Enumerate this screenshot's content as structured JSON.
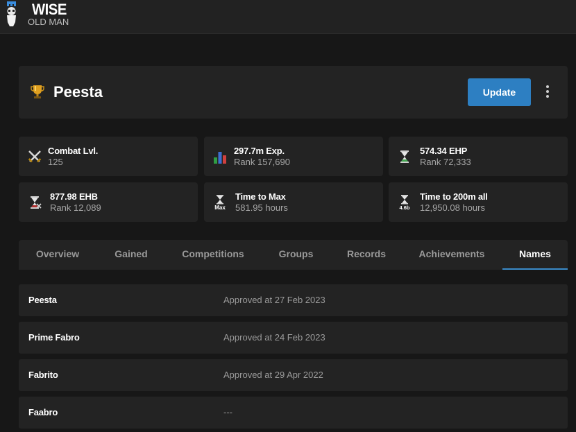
{
  "brand": {
    "title": "WISE",
    "subtitle": "OLD MAN"
  },
  "player": {
    "name": "Peesta",
    "update_label": "Update"
  },
  "stats": [
    {
      "icon": "combat-swords-icon",
      "title": "Combat Lvl.",
      "sub": "125"
    },
    {
      "icon": "experience-bars-icon",
      "title": "297.7m Exp.",
      "sub": "Rank 157,690"
    },
    {
      "icon": "ehp-hourglass-icon",
      "title": "574.34 EHP",
      "sub": "Rank 72,333"
    },
    {
      "icon": "ehb-hourglass-icon",
      "title": "877.98 EHB",
      "sub": "Rank 12,089"
    },
    {
      "icon": "max-hourglass-icon",
      "icon_label": "Max",
      "title": "Time to Max",
      "sub": "581.95 hours"
    },
    {
      "icon": "200m-hourglass-icon",
      "icon_label": "4.6b",
      "title": "Time to 200m all",
      "sub": "12,950.08 hours"
    }
  ],
  "tabs": [
    {
      "label": "Overview"
    },
    {
      "label": "Gained"
    },
    {
      "label": "Competitions"
    },
    {
      "label": "Groups"
    },
    {
      "label": "Records"
    },
    {
      "label": "Achievements"
    },
    {
      "label": "Names",
      "active": true
    }
  ],
  "names": [
    {
      "name": "Peesta",
      "status": "Approved at 27 Feb 2023"
    },
    {
      "name": "Prime Fabro",
      "status": "Approved at 24 Feb 2023"
    },
    {
      "name": "Fabrito",
      "status": "Approved at 29 Apr 2022"
    },
    {
      "name": "Faabro",
      "status": "---"
    }
  ],
  "colors": {
    "accent": "#2d7fc2",
    "card": "#232323",
    "background": "#171717"
  }
}
